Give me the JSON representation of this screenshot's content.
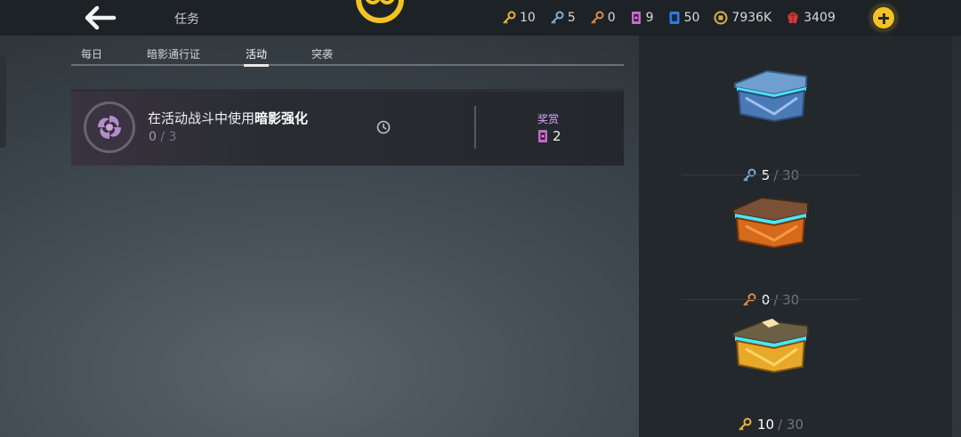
{
  "header": {
    "title": "任务",
    "resources": [
      {
        "name": "gold-key",
        "value": "10",
        "color": "#e7b23c"
      },
      {
        "name": "blue-key",
        "value": "5",
        "color": "#7eaed6"
      },
      {
        "name": "bronze-key",
        "value": "0",
        "color": "#e0894a"
      },
      {
        "name": "purple-ticket",
        "value": "9",
        "color": "#c56bcc"
      },
      {
        "name": "blue-card",
        "value": "50",
        "color": "#2f7be0"
      },
      {
        "name": "gold-coin",
        "value": "7936K",
        "color": "#d9b04a"
      },
      {
        "name": "red-gem",
        "value": "3409",
        "color": "#d33a3a"
      }
    ]
  },
  "tabs": [
    {
      "label": "每日",
      "active": false
    },
    {
      "label": "暗影通行证",
      "active": false
    },
    {
      "label": "活动",
      "active": true
    },
    {
      "label": "突袭",
      "active": false
    }
  ],
  "task": {
    "text_prefix": "在活动战斗中使用",
    "text_bold": "暗影强化",
    "progress_current": "0",
    "progress_sep": " / ",
    "progress_total": "3",
    "reward_label": "奖赏",
    "reward_value": "2"
  },
  "chests": [
    {
      "name": "blue-chest",
      "count": "5",
      "max": "/ 30",
      "key_color": "#7eaed6"
    },
    {
      "name": "bronze-chest",
      "count": "0",
      "max": "/ 30",
      "key_color": "#e0894a"
    },
    {
      "name": "gold-chest",
      "count": "10",
      "max": "/ 30",
      "key_color": "#e7b23c"
    }
  ]
}
